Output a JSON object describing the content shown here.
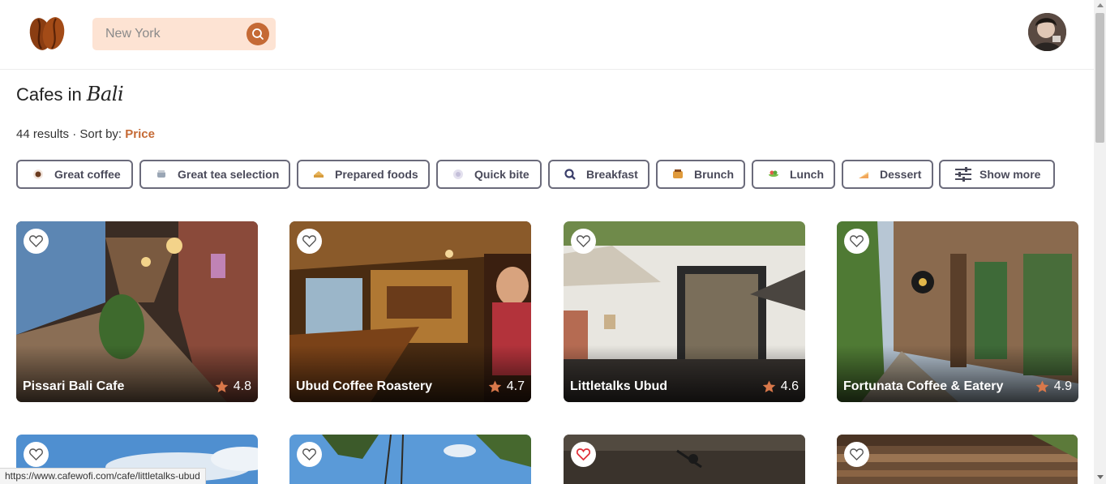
{
  "header": {
    "logo_icon": "coffee-bean-icon",
    "search": {
      "placeholder": "New York",
      "value": "",
      "icon": "search-icon"
    },
    "avatar_icon": "user-avatar"
  },
  "page": {
    "title_prefix": "Cafes in",
    "title_city": "Bali",
    "results_count": "44 results",
    "results_sep": " · ",
    "sort_label": "Sort by:",
    "sort_value": "Price"
  },
  "filters": [
    {
      "label": "Great coffee",
      "icon": "coffee-cup-icon"
    },
    {
      "label": "Great tea selection",
      "icon": "teapot-icon"
    },
    {
      "label": "Prepared foods",
      "icon": "sandwich-icon"
    },
    {
      "label": "Quick bite",
      "icon": "plate-icon"
    },
    {
      "label": "Breakfast",
      "icon": "magnifier-icon"
    },
    {
      "label": "Brunch",
      "icon": "waffle-icon"
    },
    {
      "label": "Lunch",
      "icon": "salad-icon"
    },
    {
      "label": "Dessert",
      "icon": "cake-icon"
    },
    {
      "label": "Show more",
      "icon": "sliders-icon"
    }
  ],
  "cafes": [
    {
      "name": "Pissari Bali Cafe",
      "rating": "4.8",
      "favorited": false
    },
    {
      "name": "Ubud Coffee Roastery",
      "rating": "4.7",
      "favorited": false
    },
    {
      "name": "Littletalks Ubud",
      "rating": "4.6",
      "favorited": false
    },
    {
      "name": "Fortunata Coffee & Eatery",
      "rating": "4.9",
      "favorited": false
    },
    {
      "name": "",
      "rating": "",
      "favorited": false
    },
    {
      "name": "",
      "rating": "",
      "favorited": false
    },
    {
      "name": "",
      "rating": "",
      "favorited": true
    },
    {
      "name": "",
      "rating": "",
      "favorited": false
    }
  ],
  "colors": {
    "accent": "#c56a35",
    "search_bg": "#fde3d3",
    "chip_border": "#6b6b7b",
    "heart_active": "#e0303a"
  },
  "statusbar": {
    "url": "https://www.cafewofi.com/cafe/littletalks-ubud"
  }
}
